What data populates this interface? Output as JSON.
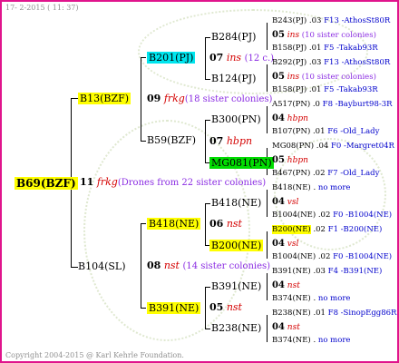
{
  "header": "17-  2-2015 ( 11: 37)",
  "footer": "Copyright 2004-2015 @ Karl Kehrle Foundation.",
  "root": {
    "label": "B69(BZF)"
  },
  "gen1": {
    "top": {
      "label": "B13(BZF)"
    },
    "mid": {
      "count": "11",
      "code": "frkg",
      "desc": "(Drones from 22 sister colonies)"
    },
    "bottom": {
      "label": "B104(SL)"
    }
  },
  "gen2": {
    "b201": {
      "label": "B201(PJ)"
    },
    "b13mid": {
      "count": "09",
      "code": "frkg",
      "desc": "(18 sister colonies)"
    },
    "b59": {
      "label": "B59(BZF)"
    },
    "b418": {
      "label": "B418(NE)"
    },
    "b104mid": {
      "count": "08",
      "code": "nst",
      "desc": "(14 sister colonies)"
    },
    "b391": {
      "label": "B391(NE)"
    }
  },
  "gen3": {
    "b284": {
      "label": "B284(PJ)"
    },
    "b201mid": {
      "count": "07",
      "code": "ins",
      "desc": "(12 c.)"
    },
    "b124": {
      "label": "B124(PJ)"
    },
    "b300": {
      "label": "B300(PN)"
    },
    "b59mid": {
      "count": "07",
      "code": "hbpn"
    },
    "mg081": {
      "label": "MG081(PN)"
    },
    "b418a": {
      "label": "B418(NE)"
    },
    "b418mid": {
      "count": "06",
      "code": "nst"
    },
    "b200": {
      "label": "B200(NE)"
    },
    "b391a": {
      "label": "B391(NE)"
    },
    "b391mid": {
      "count": "05",
      "code": "nst"
    },
    "b238": {
      "label": "B238(NE)"
    }
  },
  "gen4": [
    {
      "id": "B243(PJ)",
      "gen": ".03",
      "info": "F13 -AthosSt80R"
    },
    {
      "count": "05",
      "code": "ins",
      "desc": "(10 sister colonies)"
    },
    {
      "id": "B158(PJ)",
      "gen": ".01",
      "info": "F5 -Takab93R"
    },
    {
      "id": "B292(PJ)",
      "gen": ".03",
      "info": "F13 -AthosSt80R"
    },
    {
      "count": "05",
      "code": "ins",
      "desc": "(10 sister colonies)"
    },
    {
      "id": "B158(PJ)",
      "gen": ".01",
      "info": "F5 -Takab93R"
    },
    {
      "id": "A517(PN)",
      "gen": ".0",
      "info": "F8 -Bayburt98-3R"
    },
    {
      "count": "04",
      "code": "hbpn",
      "desc": ""
    },
    {
      "id": "B107(PN)",
      "gen": ".01",
      "info": "F6 -Old_Lady"
    },
    {
      "id": "MG08(PN)",
      "gen": ".04",
      "info": "F0 -Margret04R"
    },
    {
      "count": "05",
      "code": "hbpn",
      "desc": ""
    },
    {
      "id": "B467(PN)",
      "gen": ".02",
      "info": "F7 -Old_Lady"
    },
    {
      "id": "B418(NE)",
      "gen": ".",
      "info": "no more"
    },
    {
      "count": "04",
      "code": "vsl",
      "desc": ""
    },
    {
      "id": "B1004(NE)",
      "gen": ".02",
      "info": "F0 -B1004(NE)"
    },
    {
      "id": "B200(NE)",
      "gen": ".02",
      "info": "F1 -B200(NE)"
    },
    {
      "count": "04",
      "code": "vsl",
      "desc": ""
    },
    {
      "id": "B1004(NE)",
      "gen": ".02",
      "info": "F0 -B1004(NE)"
    },
    {
      "id": "B391(NE)",
      "gen": ".03",
      "info": "F4 -B391(NE)"
    },
    {
      "count": "04",
      "code": "nst",
      "desc": ""
    },
    {
      "id": "B374(NE)",
      "gen": ".",
      "info": "no more"
    },
    {
      "id": "B238(NE)",
      "gen": ".01",
      "info": "F8 -SinopEgg86R"
    },
    {
      "count": "04",
      "code": "nst",
      "desc": ""
    },
    {
      "id": "B374(NE)",
      "gen": ".",
      "info": "no more"
    }
  ]
}
